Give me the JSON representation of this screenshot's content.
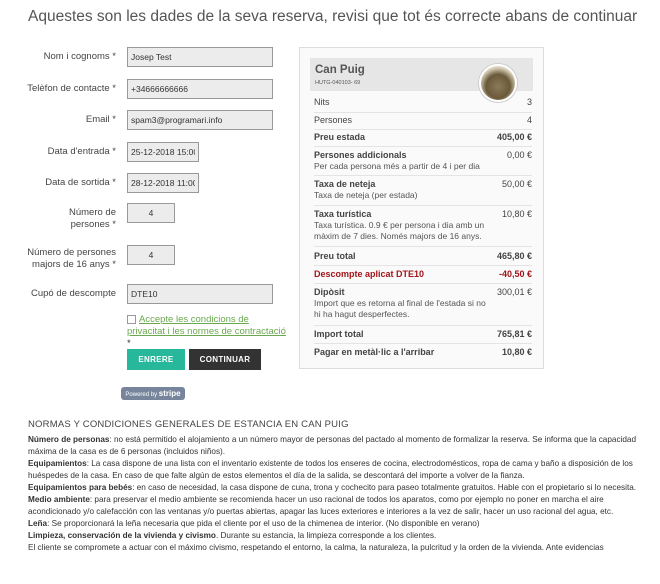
{
  "heading": "Aquestes son les dades de la seva reserva, revisi que tot és correcte abans de continuar",
  "form": {
    "name_label": "Nom i cognoms",
    "name_value": "Josep Test",
    "phone_label": "Telèfon de contacte",
    "phone_value": "+34666666666",
    "email_label": "Email",
    "email_value": "spam3@programari.info",
    "checkin_label": "Data d'entrada",
    "checkin_value": "25-12-2018 15:00",
    "checkout_label": "Data de sortida",
    "checkout_value": "28-12-2018 11:00",
    "people_label_1": "Número de",
    "people_label_2": "persones",
    "people_value": "4",
    "adults_label_1": "Número de persones",
    "adults_label_2": "majors de 16 anys",
    "adults_value": "4",
    "discount_label": "Cupó de descompte",
    "discount_value": "DTE10",
    "required_mark": "*",
    "privacy_link": "Accepte les condicions de privacitat i les normes de contractació",
    "enter_button": "ENRERE",
    "continue_button": "CONTINUAR",
    "stripe_prefix": "Powered by",
    "stripe_brand": "stripe"
  },
  "summary": {
    "property_name": "Can Puig",
    "property_code": "HUTG-040103- 69",
    "rows": [
      {
        "label": "Nits",
        "value": "3"
      },
      {
        "label": "Persones",
        "value": "4"
      },
      {
        "label": "Preu estada",
        "value": "405,00 €"
      },
      {
        "label": "Persones addicionals",
        "sub": "Per cada persona més a partir de 4 i per dia",
        "value": "0,00 €"
      },
      {
        "label": "Taxa de neteja",
        "sub": "Taxa de neteja (per estada)",
        "value": "50,00 €"
      },
      {
        "label": "Taxa turística",
        "sub": "Taxa turística. 0.9 € per persona i dia amb un màxim de 7 dies. Només majors de 16 anys.",
        "value": "10,80 €"
      },
      {
        "label": "Preu total",
        "value": "465,80 €"
      },
      {
        "label": "Descompte aplicat DTE10",
        "value": "-40,50 €"
      },
      {
        "label": "Dipòsit",
        "sub": "Import que es retorna al final de l'estada si no hi ha hagut desperfectes.",
        "value": "300,01 €"
      },
      {
        "label": "Import total",
        "value": "765,81 €"
      },
      {
        "label": "Pagar en metàl·lic a l'arribar",
        "value": "10,80 €"
      }
    ]
  },
  "conditions": {
    "title": "NORMAS Y CONDICIONES GENERALES DE ESTANCIA EN CAN PUIG",
    "p1_bold": "Número de personas",
    "p1_text": ": no está permitido el alojamiento a un número mayor de personas del pactado al momento de formalizar la reserva. Se informa que la capacidad máxima de la casa es de 6 personas (incluidos niños).",
    "p2_bold": "Equipamientos",
    "p2_text": ": La casa dispone de una lista con el inventario existente de todos los enseres de cocina, electrodomésticos, ropa de cama y baño a disposición de los huéspedes de la casa. En caso de que falte algún de estos elementos el día de la salida, se descontará del importe a volver de la fianza.",
    "p3_bold": "Equipamientos para bebés",
    "p3_text": ": en caso de necesidad, la casa dispone de cuna, trona y cochecito para paseo totalmente gratuitos. Hable con el propietario si lo necesita.",
    "p4_bold": "Medio ambiente",
    "p4_text": ": para preservar el medio ambiente se recomienda hacer un uso racional de todos los aparatos, como por ejemplo no poner en marcha el aire acondicionado y/o calefacción con las ventanas y/o puertas abiertas, apagar las luces exteriores e interiores a la vez de salir, hacer un uso racional del agua, etc.",
    "p5_bold": "Leña",
    "p5_text": ": Se proporcionará la leña necesaria que pida el cliente por el uso de la chimenea de interior. (No disponible en verano)",
    "p6_bold": "Limpieza, conservación de la vivienda y civismo",
    "p6_text": ". Durante su estancia, la limpieza corresponde a los clientes.",
    "p7_text": "El cliente se compromete a actuar con el máximo civismo, respetando el entorno, la calma, la naturaleza, la pulcritud y la orden de la vivienda. Ante evidencias"
  }
}
